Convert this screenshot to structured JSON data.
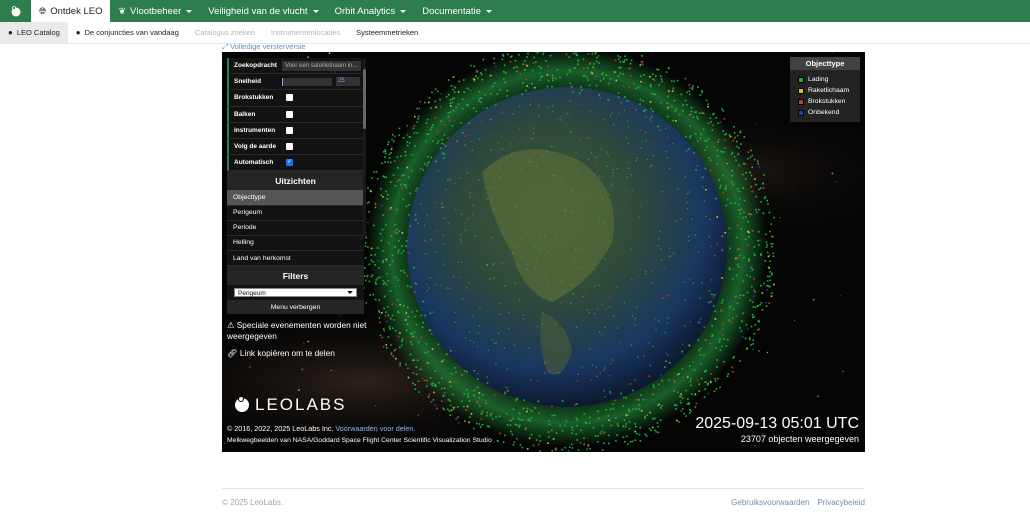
{
  "topnav": {
    "items": [
      {
        "label": "Ontdek LEO",
        "icon": "globe-icon",
        "active": true
      },
      {
        "label": "Vlootbeheer",
        "icon": "leaf-icon"
      },
      {
        "label": "Veiligheid van de vlucht"
      },
      {
        "label": "Orbit Analytics"
      },
      {
        "label": "Documentatie"
      }
    ]
  },
  "subnav": {
    "items": [
      {
        "label": "LEO Catalog",
        "icon": "leolabs-icon",
        "active": true
      },
      {
        "label": "De conjuncties van vandaag",
        "icon": "leolabs-icon"
      },
      {
        "label": "Catalogus zoeken",
        "muted": true
      },
      {
        "label": "Instrumentenlocaties",
        "muted": true
      },
      {
        "label": "Systeemmetrieken"
      }
    ]
  },
  "full_version_link": "Volledige versterversie",
  "panel": {
    "search_label": "Zoekopdracht",
    "search_placeholder": "Voer een satellietnaam in...",
    "speed_label": "Snelheid",
    "speed_value": "25",
    "checkboxes": [
      {
        "label": "Brokstukken",
        "checked": false
      },
      {
        "label": "Balken",
        "checked": false
      },
      {
        "label": "Instrumenten",
        "checked": false
      },
      {
        "label": "Volg de aarde",
        "checked": false
      },
      {
        "label": "Automatisch",
        "checked": true
      }
    ],
    "views_title": "Uitzichten",
    "views": [
      {
        "label": "Objecttype",
        "selected": true
      },
      {
        "label": "Perigeum"
      },
      {
        "label": "Periode"
      },
      {
        "label": "Helling"
      },
      {
        "label": "Land van herkomst"
      }
    ],
    "filters_title": "Filters",
    "filter_selected": "Perigeum",
    "hide_menu_label": "Menu verbergen"
  },
  "notes": {
    "special_events": "Speciale evenementen worden niet weergegeven",
    "copy_link": "Link kopiëren om te delen"
  },
  "brand": "LEOLABS",
  "copyright": "© 2016, 2022, 2025 LeoLabs Inc.",
  "terms_link": "Voorwaarden voor delen.",
  "credit": "Melkwegbeelden van NASA/Goddard Space Flight Center Scientific Visualization Studio",
  "timestamp": "2025-09-13 05:01 UTC",
  "object_count": "23707 objecten weergegeven",
  "legend": {
    "title": "Objecttype",
    "items": [
      {
        "label": "Lading",
        "color": "#1fb33a"
      },
      {
        "label": "Raketlichaam",
        "color": "#c9c438"
      },
      {
        "label": "Brokstukken",
        "color": "#c0392b"
      },
      {
        "label": "Onbekend",
        "color": "#1c3fb8"
      }
    ]
  },
  "footer": {
    "copyright": "© 2025 LeoLabs.",
    "links": [
      "Gebruiksvoorwaarden",
      "Privacybeleid"
    ]
  }
}
